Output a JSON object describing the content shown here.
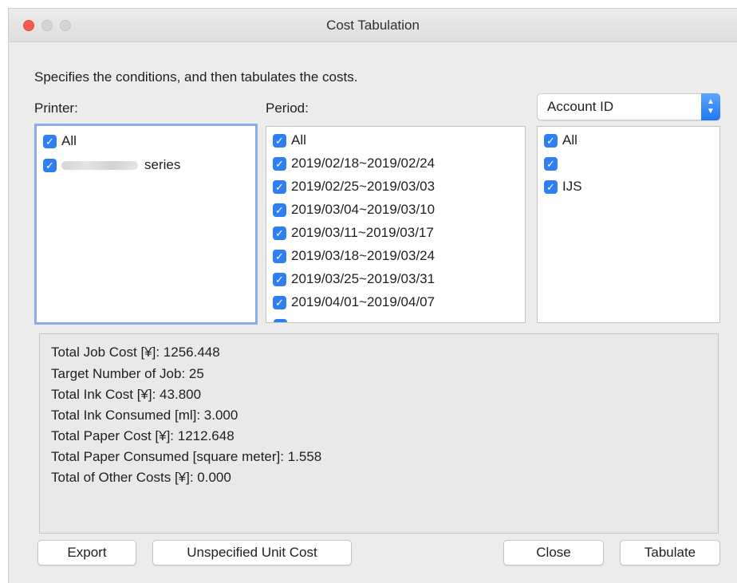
{
  "window": {
    "title": "Cost Tabulation"
  },
  "instruction": "Specifies the conditions, and then tabulates the costs.",
  "printer": {
    "label": "Printer:",
    "items": [
      {
        "label": "All",
        "checked": true
      },
      {
        "label": "series",
        "checked": true
      }
    ]
  },
  "period": {
    "label": "Period:",
    "items": [
      {
        "label": "All",
        "checked": true
      },
      {
        "label": "2019/02/18~2019/02/24",
        "checked": true
      },
      {
        "label": "2019/02/25~2019/03/03",
        "checked": true
      },
      {
        "label": "2019/03/04~2019/03/10",
        "checked": true
      },
      {
        "label": "2019/03/11~2019/03/17",
        "checked": true
      },
      {
        "label": "2019/03/18~2019/03/24",
        "checked": true
      },
      {
        "label": "2019/03/25~2019/03/31",
        "checked": true
      },
      {
        "label": "2019/04/01~2019/04/07",
        "checked": true
      }
    ]
  },
  "account": {
    "select_value": "Account ID",
    "items": [
      {
        "label": "All",
        "checked": true
      },
      {
        "label": "",
        "checked": true
      },
      {
        "label": "IJS",
        "checked": true
      }
    ]
  },
  "results": [
    "Total Job Cost [¥]: 1256.448",
    "Target Number of Job: 25",
    "Total Ink Cost [¥]: 43.800",
    "Total Ink Consumed [ml]: 3.000",
    "Total Paper Cost [¥]: 1212.648",
    "Total Paper Consumed [square meter]: 1.558",
    "Total of Other Costs [¥]: 0.000"
  ],
  "buttons": {
    "export": "Export",
    "unspecified_unit_cost": "Unspecified Unit Cost",
    "close": "Close",
    "tabulate": "Tabulate"
  },
  "colors": {
    "checkbox_accent": "#2f7ff3",
    "close_light": "#f25c54",
    "focus_ring": "#87aee8"
  }
}
